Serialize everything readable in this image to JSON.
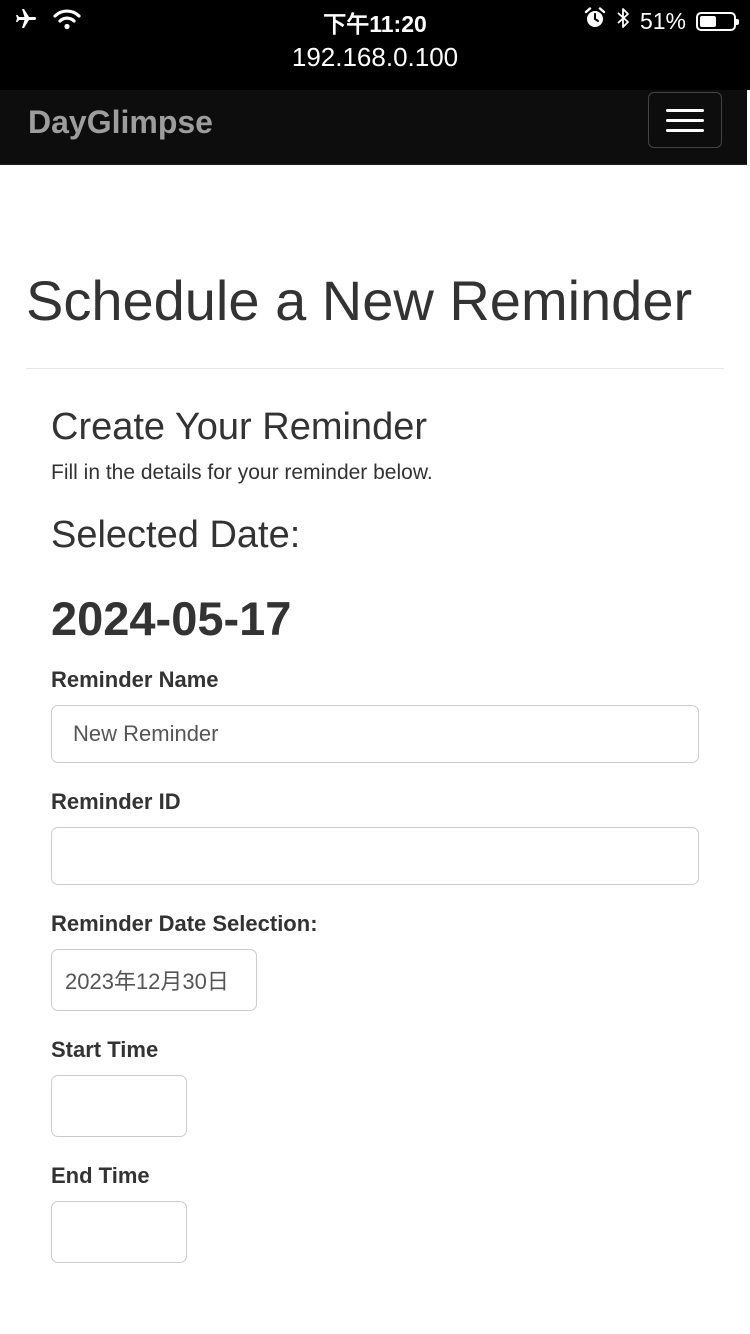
{
  "status_bar": {
    "time": "下午11:20",
    "url": "192.168.0.100",
    "battery_text": "51%",
    "battery_level": 0.51,
    "icons": [
      "airplane-icon",
      "wifi-icon",
      "alarm-icon",
      "bluetooth-icon",
      "battery-icon"
    ]
  },
  "navbar": {
    "brand": "DayGlimpse",
    "menu_icon": "hamburger-icon",
    "brand_color": "#9d9d9d",
    "background": "#0d0d0d"
  },
  "page": {
    "title": "Schedule a New Reminder"
  },
  "form": {
    "heading": "Create Your Reminder",
    "subtitle": "Fill in the details for your reminder below.",
    "selected_date_label": "Selected Date:",
    "selected_date": "2024-05-17",
    "name_label": "Reminder Name",
    "name_value": "New Reminder",
    "id_label": "Reminder ID",
    "id_value": "",
    "date_selection_label": "Reminder Date Selection:",
    "date_selection_value": "2023年12月30日",
    "start_time_label": "Start Time",
    "end_time_label": "End Time"
  }
}
